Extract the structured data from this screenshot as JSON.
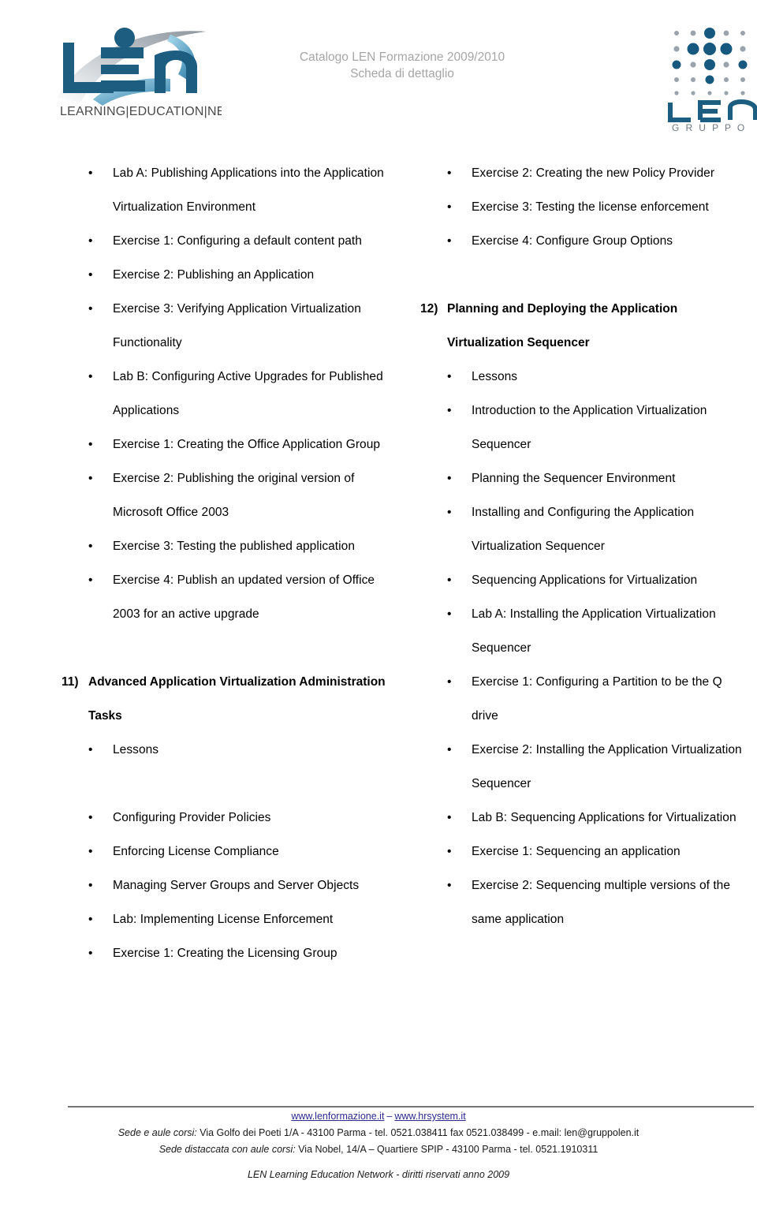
{
  "header": {
    "title_line1": "Catalogo LEN Formazione 2009/2010",
    "title_line2": "Scheda di dettaglio",
    "title_color": "#a6a6a6",
    "logo_left_text": "LEARNING|EDUCATION|NETWORK",
    "logo_left_mark": "len",
    "logo_right_mark": "LEN",
    "logo_right_text": "G R U P P O"
  },
  "left_column": {
    "blocks": [
      {
        "kind": "bullet",
        "text": "Lab A: Publishing Applications into the Application Virtualization Environment"
      },
      {
        "kind": "bullet",
        "text": "Exercise 1: Configuring a default content path"
      },
      {
        "kind": "bullet",
        "text": "Exercise 2: Publishing an Application"
      },
      {
        "kind": "bullet",
        "text": "Exercise 3: Verifying Application Virtualization Functionality"
      },
      {
        "kind": "bullet",
        "text": "Lab B: Configuring Active Upgrades for Published Applications"
      },
      {
        "kind": "bullet",
        "text": "Exercise 1: Creating the Office Application Group"
      },
      {
        "kind": "bullet",
        "text": "Exercise 2: Publishing the original version of Microsoft Office 2003"
      },
      {
        "kind": "bullet",
        "text": "Exercise 3: Testing the published application"
      },
      {
        "kind": "bullet",
        "text": "Exercise 4: Publish an updated version of Office 2003 for an active upgrade"
      },
      {
        "kind": "spacer-md",
        "text": ""
      },
      {
        "kind": "heading",
        "number": "11)",
        "text": "Advanced Application Virtualization Administration Tasks"
      },
      {
        "kind": "bullet",
        "text": "Lessons"
      },
      {
        "kind": "spacer-md",
        "text": ""
      },
      {
        "kind": "bullet",
        "text": "Configuring Provider Policies"
      },
      {
        "kind": "bullet",
        "text": "Enforcing License Compliance"
      },
      {
        "kind": "bullet",
        "text": "Managing Server Groups and Server Objects"
      },
      {
        "kind": "bullet",
        "text": "Lab: Implementing License Enforcement"
      },
      {
        "kind": "bullet",
        "text": "Exercise 1: Creating the Licensing Group"
      }
    ]
  },
  "right_column": {
    "blocks": [
      {
        "kind": "bullet",
        "text": "Exercise 2: Creating the new Policy Provider"
      },
      {
        "kind": "bullet",
        "text": "Exercise 3: Testing the license enforcement"
      },
      {
        "kind": "bullet",
        "text": "Exercise 4: Configure Group Options"
      },
      {
        "kind": "spacer-md",
        "text": ""
      },
      {
        "kind": "heading",
        "number": "12)",
        "text": "Planning and Deploying the Application Virtualization Sequencer"
      },
      {
        "kind": "bullet",
        "text": "Lessons"
      },
      {
        "kind": "bullet",
        "text": "Introduction to the Application Virtualization Sequencer"
      },
      {
        "kind": "bullet",
        "text": "Planning the Sequencer Environment"
      },
      {
        "kind": "bullet",
        "text": "Installing and Configuring the Application Virtualization Sequencer"
      },
      {
        "kind": "bullet",
        "text": "Sequencing Applications for Virtualization"
      },
      {
        "kind": "bullet",
        "text": "Lab A: Installing the Application Virtualization Sequencer"
      },
      {
        "kind": "bullet",
        "text": "Exercise 1: Configuring a Partition to be the Q drive"
      },
      {
        "kind": "bullet",
        "text": "Exercise 2: Installing the Application Virtualization Sequencer"
      },
      {
        "kind": "bullet",
        "text": "Lab B: Sequencing Applications for Virtualization"
      },
      {
        "kind": "bullet",
        "text": "Exercise 1: Sequencing an application"
      },
      {
        "kind": "bullet",
        "text": "Exercise 2: Sequencing multiple versions of the same application"
      }
    ]
  },
  "footer": {
    "link1": "www.lenformazione.it",
    "separator": "–",
    "link2": "www.hrsystem.it",
    "address_line1_label": "Sede e aule corsi:",
    "address_line1_rest": " Via Golfo dei Poeti 1/A - 43100 Parma -  tel. 0521.038411 fax 0521.038499 - e.mail: len@gruppolen.it",
    "address_line2_label": "Sede distaccata con aule corsi:",
    "address_line2_rest": " Via  Nobel, 14/A – Quartiere SPIP - 43100 Parma - tel. 0521.1910311",
    "copyright": "LEN Learning Education Network  - diritti riservati anno 2009",
    "link_color": "#2b2b8f",
    "rule_color": "#767676"
  }
}
